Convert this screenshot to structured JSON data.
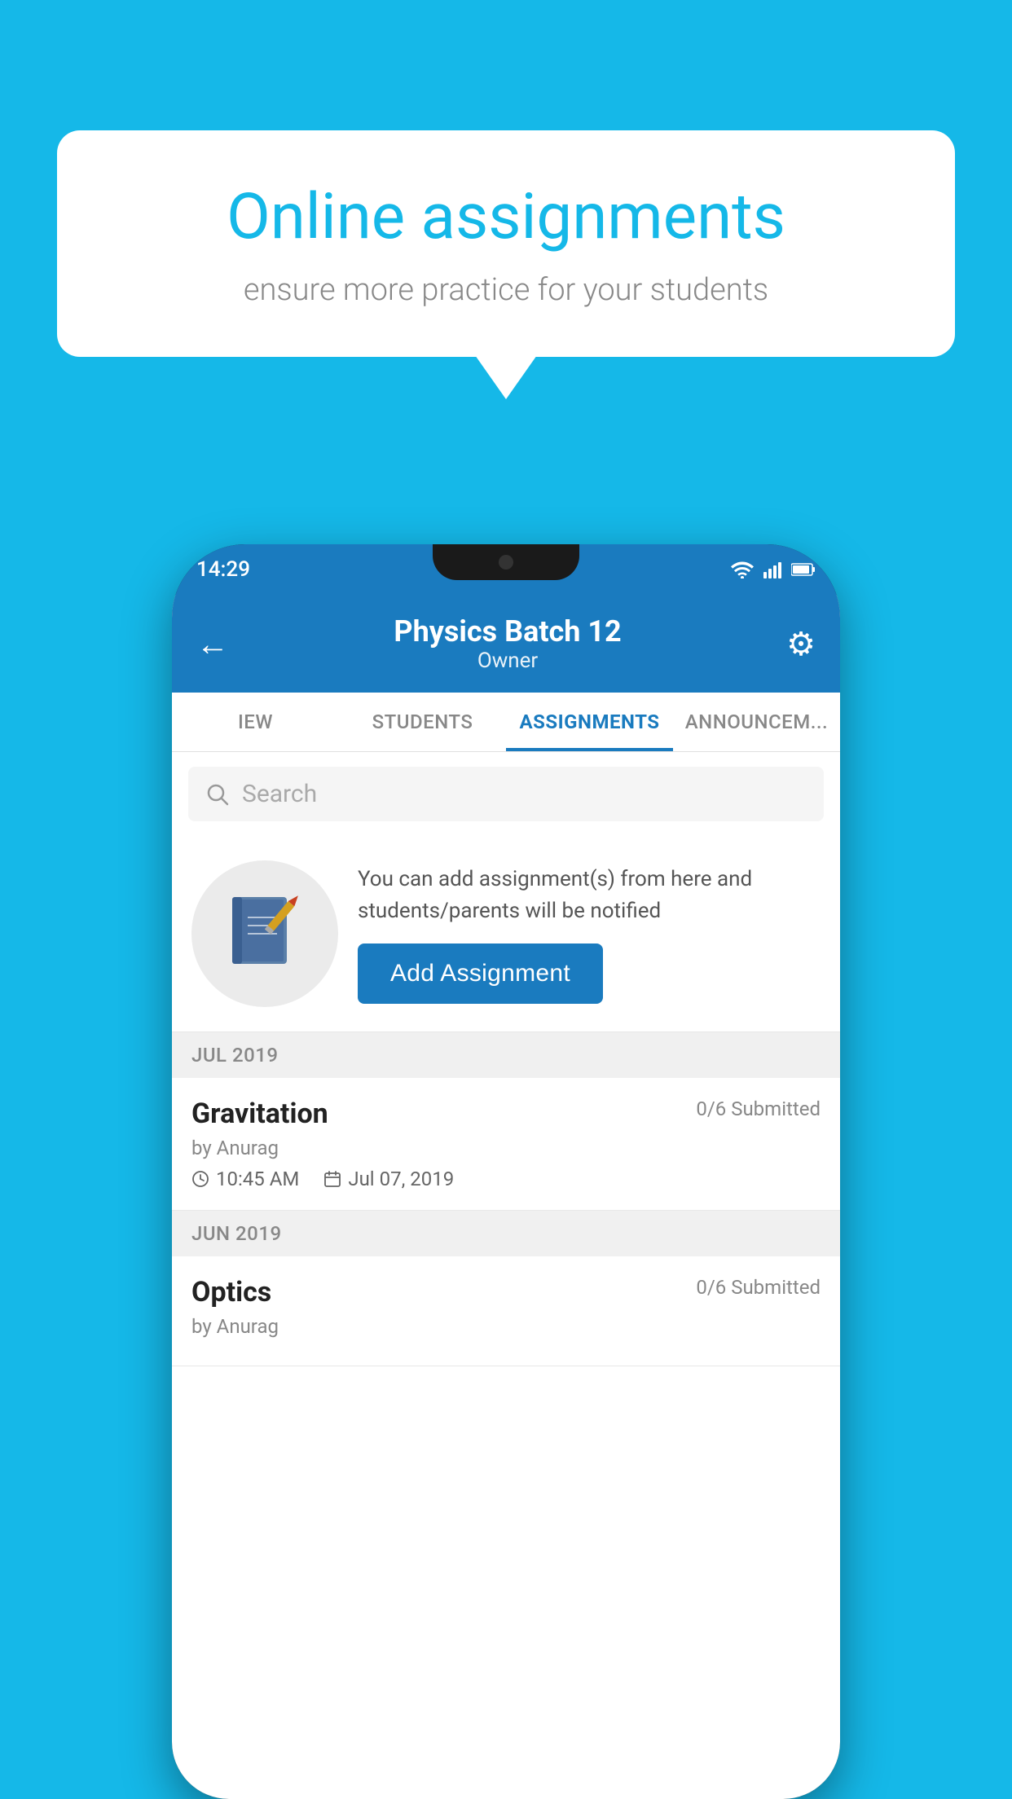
{
  "background_color": "#15b8e8",
  "speech_bubble": {
    "title": "Online assignments",
    "subtitle": "ensure more practice for your students"
  },
  "phone": {
    "status_bar": {
      "time": "14:29",
      "icons": [
        "wifi",
        "signal",
        "battery"
      ]
    },
    "header": {
      "title": "Physics Batch 12",
      "subtitle": "Owner",
      "back_label": "←",
      "settings_label": "⚙"
    },
    "tabs": [
      {
        "label": "IEW",
        "active": false
      },
      {
        "label": "STUDENTS",
        "active": false
      },
      {
        "label": "ASSIGNMENTS",
        "active": true
      },
      {
        "label": "ANNOUNCEM...",
        "active": false
      }
    ],
    "search": {
      "placeholder": "Search"
    },
    "promo": {
      "text": "You can add assignment(s) from here and students/parents will be notified",
      "button_label": "Add Assignment"
    },
    "sections": [
      {
        "month": "JUL 2019",
        "assignments": [
          {
            "title": "Gravitation",
            "status": "0/6 Submitted",
            "author": "by Anurag",
            "time": "10:45 AM",
            "date": "Jul 07, 2019"
          }
        ]
      },
      {
        "month": "JUN 2019",
        "assignments": [
          {
            "title": "Optics",
            "status": "0/6 Submitted",
            "author": "by Anurag",
            "time": "",
            "date": ""
          }
        ]
      }
    ]
  }
}
